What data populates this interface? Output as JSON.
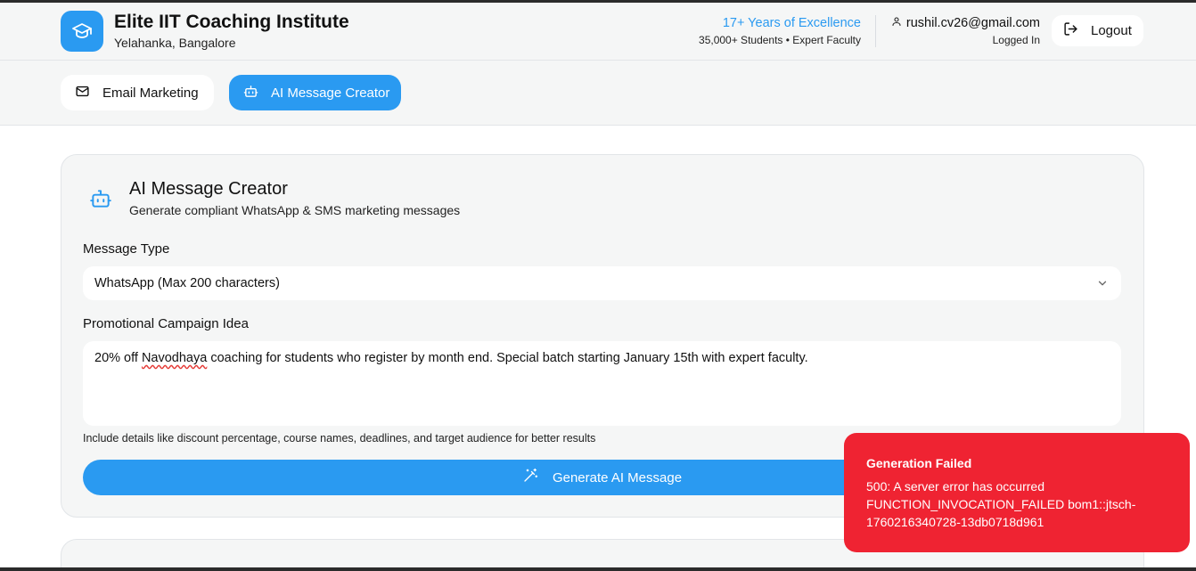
{
  "header": {
    "institute_name": "Elite IIT Coaching Institute",
    "location": "Yelahanka, Bangalore",
    "tagline": "17+ Years of Excellence",
    "stats": "35,000+ Students • Expert Faculty",
    "user_email": "rushil.cv26@gmail.com",
    "user_status": "Logged In",
    "logout_label": "Logout"
  },
  "tabs": [
    {
      "label": "Email Marketing",
      "icon": "mail-icon",
      "active": false
    },
    {
      "label": "AI Message Creator",
      "icon": "bot-icon",
      "active": true
    }
  ],
  "card": {
    "title": "AI Message Creator",
    "subtitle": "Generate compliant WhatsApp & SMS marketing messages",
    "message_type_label": "Message Type",
    "message_type_value": "WhatsApp (Max 200 characters)",
    "campaign_label": "Promotional Campaign Idea",
    "campaign_text_before": "20% off ",
    "campaign_text_misspelled": "Navodhaya",
    "campaign_text_after": " coaching for students who register by month end. Special batch starting January 15th with expert faculty.",
    "hint": "Include details like discount percentage, course names, deadlines, and target audience for better results",
    "generate_label": "Generate AI Message"
  },
  "toast": {
    "title": "Generation Failed",
    "message": "500: A server error has occurred\nFUNCTION_INVOCATION_FAILED bom1::jtsch-\n1760216340728-13db0718d961"
  },
  "colors": {
    "accent": "#2a9af1",
    "error": "#ef2332",
    "panel": "#f5f6f6"
  }
}
